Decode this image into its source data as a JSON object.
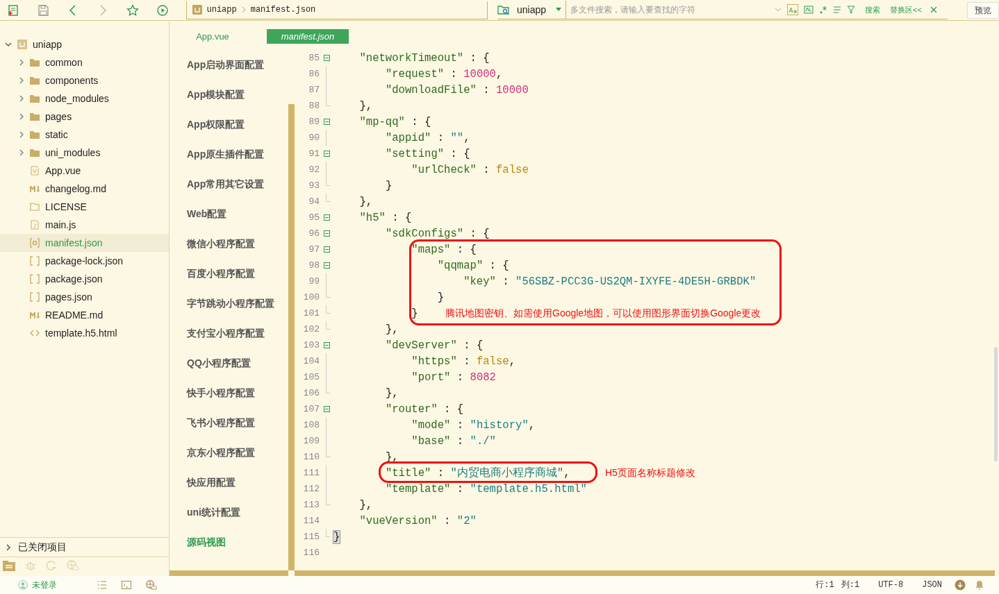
{
  "toolbar": {
    "breadcrumb": [
      "uniapp",
      "manifest.json"
    ],
    "search_scope": "uniapp",
    "search": {
      "placeholder": "多文件搜索，请输入要查找的字符"
    },
    "search_button": "搜索",
    "replace_button": "替换区<<",
    "preview_button": "预览"
  },
  "project_tree": {
    "root": {
      "label": "uniapp",
      "expanded": true,
      "children": [
        {
          "label": "common",
          "kind": "folder",
          "selected": false
        },
        {
          "label": "components",
          "kind": "folder",
          "selected": false
        },
        {
          "label": "node_modules",
          "kind": "folder",
          "selected": false
        },
        {
          "label": "pages",
          "kind": "folder",
          "selected": false
        },
        {
          "label": "static",
          "kind": "folder",
          "selected": false
        },
        {
          "label": "uni_modules",
          "kind": "folder",
          "selected": false
        },
        {
          "label": "App.vue",
          "kind": "vue",
          "selected": false
        },
        {
          "label": "changelog.md",
          "kind": "md",
          "selected": false
        },
        {
          "label": "LICENSE",
          "kind": "file",
          "selected": false
        },
        {
          "label": "main.js",
          "kind": "js",
          "selected": false
        },
        {
          "label": "manifest.json",
          "kind": "manifest",
          "selected": true
        },
        {
          "label": "package-lock.json",
          "kind": "json",
          "selected": false
        },
        {
          "label": "package.json",
          "kind": "json",
          "selected": false
        },
        {
          "label": "pages.json",
          "kind": "json",
          "selected": false
        },
        {
          "label": "README.md",
          "kind": "md",
          "selected": false
        },
        {
          "label": "template.h5.html",
          "kind": "html",
          "selected": false
        }
      ]
    },
    "closed_projects": "已关闭项目"
  },
  "editor_tabs": [
    {
      "label": "App.vue",
      "selected": false
    },
    {
      "label": "manifest.json",
      "selected": true
    }
  ],
  "config_nav": [
    {
      "label": "App启动界面配置",
      "selected": false
    },
    {
      "label": "App模块配置",
      "selected": false
    },
    {
      "label": "App权限配置",
      "selected": false
    },
    {
      "label": "App原生插件配置",
      "selected": false
    },
    {
      "label": "App常用其它设置",
      "selected": false
    },
    {
      "label": "Web配置",
      "selected": false
    },
    {
      "label": "微信小程序配置",
      "selected": false
    },
    {
      "label": "百度小程序配置",
      "selected": false
    },
    {
      "label": "字节跳动小程序配置",
      "selected": false
    },
    {
      "label": "支付宝小程序配置",
      "selected": false
    },
    {
      "label": "QQ小程序配置",
      "selected": false
    },
    {
      "label": "快手小程序配置",
      "selected": false
    },
    {
      "label": "飞书小程序配置",
      "selected": false
    },
    {
      "label": "京东小程序配置",
      "selected": false
    },
    {
      "label": "快应用配置",
      "selected": false
    },
    {
      "label": "uni统计配置",
      "selected": false
    },
    {
      "label": "源码视图",
      "selected": true
    }
  ],
  "code_lines": [
    {
      "number": "85",
      "fold_start": true,
      "fold_end": false,
      "guide": false,
      "tokens": [
        {
          "kind": "key",
          "text": "    \"networkTimeout\""
        },
        {
          "kind": "punct",
          "text": " : {"
        }
      ]
    },
    {
      "number": "86",
      "fold_start": false,
      "fold_end": false,
      "guide": true,
      "tokens": [
        {
          "kind": "key",
          "text": "        \"request\""
        },
        {
          "kind": "punct",
          "text": " : "
        },
        {
          "kind": "number",
          "text": "10000"
        },
        {
          "kind": "punct",
          "text": ","
        }
      ]
    },
    {
      "number": "87",
      "fold_start": false,
      "fold_end": false,
      "guide": true,
      "tokens": [
        {
          "kind": "key",
          "text": "        \"downloadFile\""
        },
        {
          "kind": "punct",
          "text": " : "
        },
        {
          "kind": "number",
          "text": "10000"
        }
      ]
    },
    {
      "number": "88",
      "fold_start": false,
      "fold_end": true,
      "guide": false,
      "tokens": [
        {
          "kind": "punct",
          "text": "    },"
        }
      ]
    },
    {
      "number": "89",
      "fold_start": true,
      "fold_end": false,
      "guide": false,
      "tokens": [
        {
          "kind": "key",
          "text": "    \"mp-qq\""
        },
        {
          "kind": "punct",
          "text": " : {"
        }
      ]
    },
    {
      "number": "90",
      "fold_start": false,
      "fold_end": false,
      "guide": true,
      "tokens": [
        {
          "kind": "key",
          "text": "        \"appid\""
        },
        {
          "kind": "punct",
          "text": " : "
        },
        {
          "kind": "string",
          "text": "\"\""
        },
        {
          "kind": "punct",
          "text": ","
        }
      ]
    },
    {
      "number": "91",
      "fold_start": true,
      "fold_end": false,
      "guide": false,
      "tokens": [
        {
          "kind": "key",
          "text": "        \"setting\""
        },
        {
          "kind": "punct",
          "text": " : {"
        }
      ]
    },
    {
      "number": "92",
      "fold_start": false,
      "fold_end": false,
      "guide": true,
      "tokens": [
        {
          "kind": "key",
          "text": "            \"urlCheck\""
        },
        {
          "kind": "punct",
          "text": " : "
        },
        {
          "kind": "bool",
          "text": "false"
        }
      ]
    },
    {
      "number": "93",
      "fold_start": false,
      "fold_end": true,
      "guide": false,
      "tokens": [
        {
          "kind": "punct",
          "text": "        }"
        }
      ]
    },
    {
      "number": "94",
      "fold_start": false,
      "fold_end": true,
      "guide": false,
      "tokens": [
        {
          "kind": "punct",
          "text": "    },"
        }
      ]
    },
    {
      "number": "95",
      "fold_start": true,
      "fold_end": false,
      "guide": false,
      "tokens": [
        {
          "kind": "key",
          "text": "    \"h5\""
        },
        {
          "kind": "punct",
          "text": " : {"
        }
      ]
    },
    {
      "number": "96",
      "fold_start": true,
      "fold_end": false,
      "guide": false,
      "tokens": [
        {
          "kind": "key",
          "text": "        \"sdkConfigs\""
        },
        {
          "kind": "punct",
          "text": " : {"
        }
      ]
    },
    {
      "number": "97",
      "fold_start": true,
      "fold_end": false,
      "guide": false,
      "tokens": [
        {
          "kind": "key",
          "text": "            \"maps\""
        },
        {
          "kind": "punct",
          "text": " : {"
        }
      ]
    },
    {
      "number": "98",
      "fold_start": true,
      "fold_end": false,
      "guide": false,
      "tokens": [
        {
          "kind": "key",
          "text": "                \"qqmap\""
        },
        {
          "kind": "punct",
          "text": " : {"
        }
      ]
    },
    {
      "number": "99",
      "fold_start": false,
      "fold_end": false,
      "guide": true,
      "tokens": [
        {
          "kind": "key",
          "text": "                    \"key\""
        },
        {
          "kind": "punct",
          "text": " : "
        },
        {
          "kind": "string",
          "text": "\"56SBZ-PCC3G-US2QM-IXYFE-4DE5H-GRBDK\""
        }
      ]
    },
    {
      "number": "100",
      "fold_start": false,
      "fold_end": true,
      "guide": false,
      "tokens": [
        {
          "kind": "punct",
          "text": "                }"
        }
      ]
    },
    {
      "number": "101",
      "fold_start": false,
      "fold_end": true,
      "guide": false,
      "tokens": [
        {
          "kind": "punct",
          "text": "            }"
        }
      ]
    },
    {
      "number": "102",
      "fold_start": false,
      "fold_end": true,
      "guide": false,
      "tokens": [
        {
          "kind": "punct",
          "text": "        },"
        }
      ]
    },
    {
      "number": "103",
      "fold_start": true,
      "fold_end": false,
      "guide": false,
      "tokens": [
        {
          "kind": "key",
          "text": "        \"devServer\""
        },
        {
          "kind": "punct",
          "text": " : {"
        }
      ]
    },
    {
      "number": "104",
      "fold_start": false,
      "fold_end": false,
      "guide": true,
      "tokens": [
        {
          "kind": "key",
          "text": "            \"https\""
        },
        {
          "kind": "punct",
          "text": " : "
        },
        {
          "kind": "bool",
          "text": "false"
        },
        {
          "kind": "punct",
          "text": ","
        }
      ]
    },
    {
      "number": "105",
      "fold_start": false,
      "fold_end": false,
      "guide": true,
      "tokens": [
        {
          "kind": "key",
          "text": "            \"port\""
        },
        {
          "kind": "punct",
          "text": " : "
        },
        {
          "kind": "number",
          "text": "8082"
        }
      ]
    },
    {
      "number": "106",
      "fold_start": false,
      "fold_end": true,
      "guide": false,
      "tokens": [
        {
          "kind": "punct",
          "text": "        },"
        }
      ]
    },
    {
      "number": "107",
      "fold_start": true,
      "fold_end": false,
      "guide": false,
      "tokens": [
        {
          "kind": "key",
          "text": "        \"router\""
        },
        {
          "kind": "punct",
          "text": " : {"
        }
      ]
    },
    {
      "number": "108",
      "fold_start": false,
      "fold_end": false,
      "guide": true,
      "tokens": [
        {
          "kind": "key",
          "text": "            \"mode\""
        },
        {
          "kind": "punct",
          "text": " : "
        },
        {
          "kind": "string",
          "text": "\"history\""
        },
        {
          "kind": "punct",
          "text": ","
        }
      ]
    },
    {
      "number": "109",
      "fold_start": false,
      "fold_end": false,
      "guide": true,
      "tokens": [
        {
          "kind": "key",
          "text": "            \"base\""
        },
        {
          "kind": "punct",
          "text": " : "
        },
        {
          "kind": "string",
          "text": "\"./\""
        }
      ]
    },
    {
      "number": "110",
      "fold_start": false,
      "fold_end": true,
      "guide": false,
      "tokens": [
        {
          "kind": "punct",
          "text": "        },"
        }
      ]
    },
    {
      "number": "111",
      "fold_start": false,
      "fold_end": false,
      "guide": true,
      "tokens": [
        {
          "kind": "key",
          "text": "        \"title\""
        },
        {
          "kind": "punct",
          "text": " : "
        },
        {
          "kind": "string",
          "text": "\"内贸电商小程序商城\""
        },
        {
          "kind": "punct",
          "text": ","
        }
      ]
    },
    {
      "number": "112",
      "fold_start": false,
      "fold_end": false,
      "guide": true,
      "tokens": [
        {
          "kind": "key",
          "text": "        \"template\""
        },
        {
          "kind": "punct",
          "text": " : "
        },
        {
          "kind": "string",
          "text": "\"template.h5.html\""
        }
      ]
    },
    {
      "number": "113",
      "fold_start": false,
      "fold_end": true,
      "guide": false,
      "tokens": [
        {
          "kind": "punct",
          "text": "    },"
        }
      ]
    },
    {
      "number": "114",
      "fold_start": false,
      "fold_end": false,
      "guide": false,
      "tokens": [
        {
          "kind": "key",
          "text": "    \"vueVersion\""
        },
        {
          "kind": "punct",
          "text": " : "
        },
        {
          "kind": "string",
          "text": "\"2\""
        }
      ]
    },
    {
      "number": "115",
      "fold_start": false,
      "fold_end": true,
      "guide": false,
      "tokens": [
        {
          "kind": "brace",
          "text": "}"
        }
      ]
    },
    {
      "number": "116",
      "fold_start": false,
      "fold_end": false,
      "guide": false
    }
  ],
  "annotations": [
    {
      "kind": "maps",
      "text": "腾讯地图密钥、如需使用Google地图，可以使用图形界面切换Google更改"
    },
    {
      "kind": "title",
      "text": "H5页面名称标题修改"
    }
  ],
  "status_bar": {
    "user": "未登录",
    "position_line": "行:1",
    "position_col": "列:1",
    "encoding": "UTF-8",
    "language": "JSON"
  }
}
